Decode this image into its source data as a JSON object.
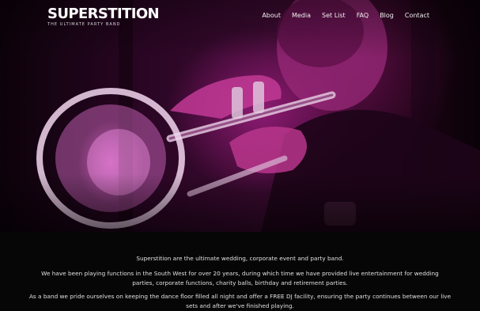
{
  "logo": {
    "name": "SUPERSTITION",
    "tagline": "THE ULTIMATE PARTY BAND"
  },
  "nav": {
    "items": [
      {
        "label": "About"
      },
      {
        "label": "Media"
      },
      {
        "label": "Set List"
      },
      {
        "label": "FAQ"
      },
      {
        "label": "Blog"
      },
      {
        "label": "Contact"
      }
    ]
  },
  "content": {
    "p1": "Superstition are the ultimate wedding, corporate event and party band.",
    "p2": "We have been playing functions in the South West for over 20 years, during which time we have provided live entertainment for wedding parties, corporate functions, charity balls, birthday and retirement parties.",
    "p3": "As a band we pride ourselves on keeping the dance floor filled all night and offer a FREE DJ facility, ensuring the party continues between our live sets and after we've finished playing."
  },
  "colors": {
    "background": "#070607",
    "hero_magenta": "#c21a9a",
    "text": "#e0e0e0"
  }
}
